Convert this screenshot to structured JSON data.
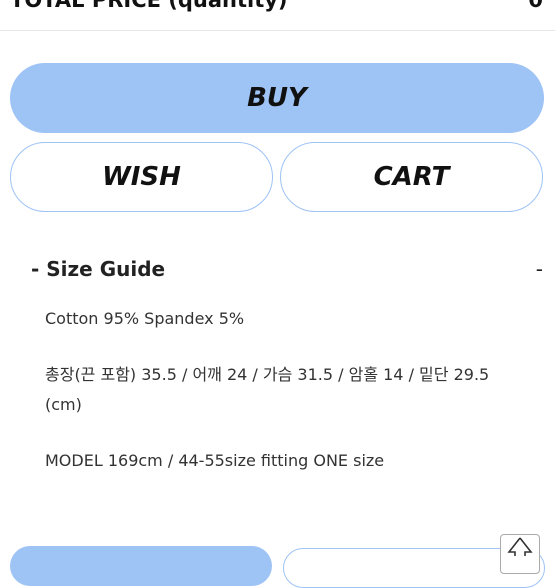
{
  "summary": {
    "total_label": "TOTAL PRICE (quantity)",
    "total_value": "0"
  },
  "actions": {
    "buy_label": "BUY",
    "wish_label": "WISH",
    "cart_label": "CART"
  },
  "size_guide": {
    "title": "- Size Guide",
    "toggle": "-",
    "material": "Cotton 95% Spandex 5%",
    "measurements": "총장(끈 포함) 35.5 / 어깨 24 / 가슴 31.5 / 암홀 14 / 밑단 29.5 (cm)",
    "model": "MODEL 169cm / 44-55size fitting ONE size"
  },
  "colors": {
    "accent": "#9ec3f5"
  },
  "icons": {
    "scroll_top": "arrow-up-icon"
  }
}
